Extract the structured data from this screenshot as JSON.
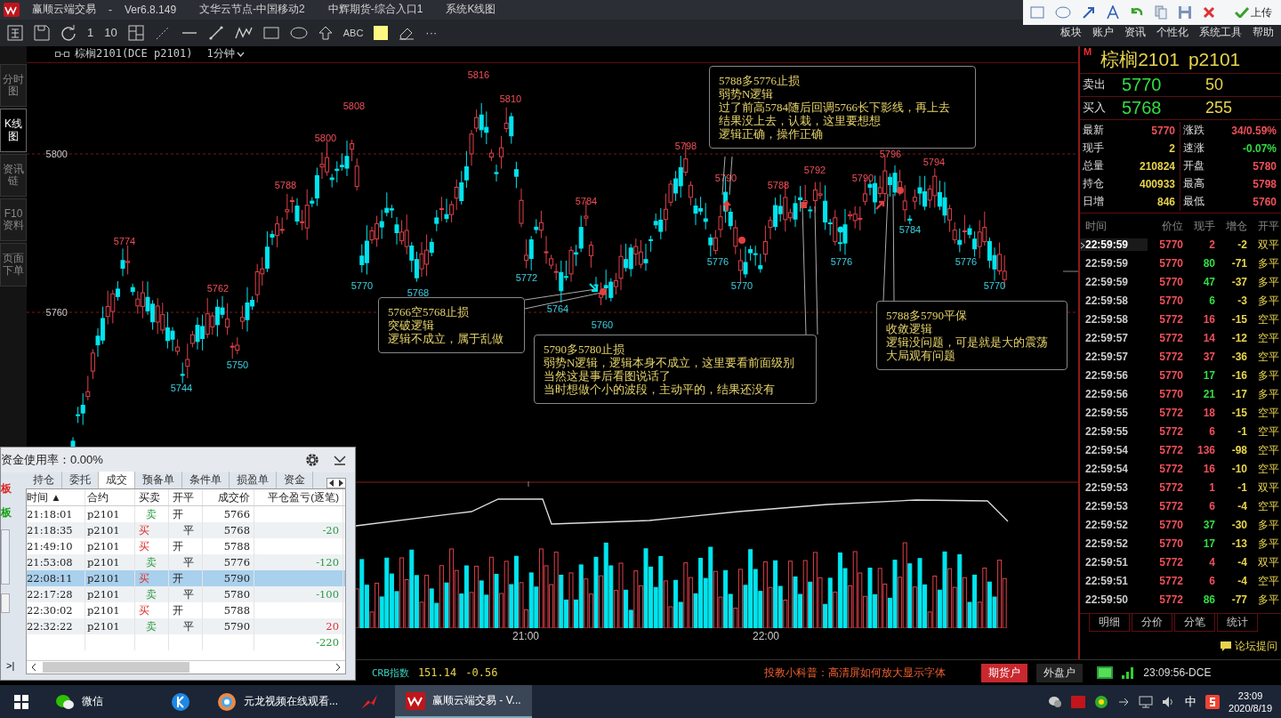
{
  "title_bar": {
    "app_name": "赢顺云端交易",
    "separator": "-",
    "version": "Ver6.8.149",
    "items": [
      "文华云节点-中国移动2",
      "中辉期货-综合入口1",
      "系统K线图"
    ]
  },
  "draw_toolbar": {
    "upload_label": "上传"
  },
  "toolbar": {
    "one": "1",
    "ten": "10",
    "abc": "ABC",
    "more": "···"
  },
  "menu": [
    "板块",
    "账户",
    "资讯",
    "个性化",
    "系统工具",
    "帮助"
  ],
  "chart_header": {
    "symbol": "棕榈2101(DCE p2101)",
    "period": "1分钟"
  },
  "side_tabs": [
    {
      "label": "分时图",
      "selected": false
    },
    {
      "label": "K线图",
      "selected": true
    },
    {
      "label": "资讯链",
      "selected": false
    },
    {
      "label": "F10资料",
      "selected": false
    },
    {
      "label": "页面下单",
      "selected": false
    }
  ],
  "price_axis": [
    "5800",
    "5760"
  ],
  "time_axis": [
    "21:00",
    "22:00"
  ],
  "price_marks": [
    {
      "text": "5774",
      "kind": "high"
    },
    {
      "text": "5744",
      "kind": "low"
    },
    {
      "text": "5762",
      "kind": "high"
    },
    {
      "text": "5750",
      "kind": "low"
    },
    {
      "text": "5788",
      "kind": "high"
    },
    {
      "text": "5800",
      "kind": "high"
    },
    {
      "text": "5808",
      "kind": "high"
    },
    {
      "text": "5770",
      "kind": "low"
    },
    {
      "text": "5768",
      "kind": "low"
    },
    {
      "text": "5816",
      "kind": "high"
    },
    {
      "text": "5810",
      "kind": "high"
    },
    {
      "text": "5772",
      "kind": "low"
    },
    {
      "text": "5764",
      "kind": "low"
    },
    {
      "text": "5784",
      "kind": "high"
    },
    {
      "text": "5760",
      "kind": "low"
    },
    {
      "text": "5798",
      "kind": "high"
    },
    {
      "text": "5776",
      "kind": "low"
    },
    {
      "text": "5790",
      "kind": "high"
    },
    {
      "text": "5770",
      "kind": "low"
    },
    {
      "text": "5788",
      "kind": "high"
    },
    {
      "text": "5792",
      "kind": "high"
    },
    {
      "text": "5776",
      "kind": "low"
    },
    {
      "text": "5790",
      "kind": "high"
    },
    {
      "text": "5796",
      "kind": "high"
    },
    {
      "text": "5784",
      "kind": "low"
    },
    {
      "text": "5794",
      "kind": "high"
    },
    {
      "text": "5776",
      "kind": "low"
    },
    {
      "text": "5770",
      "kind": "low"
    }
  ],
  "annotations": [
    {
      "lines": [
        "5766空5768止损",
        "突破逻辑",
        "逻辑不成立，属于乱做"
      ]
    },
    {
      "lines": [
        "5790多5780止损",
        "弱势N逻辑，逻辑本身不成立，这里要看前面级别",
        "当然这是事后看图说话了",
        "当时想做个小的波段，主动平的，结果还没有"
      ]
    },
    {
      "lines": [
        "5788多5776止损",
        "弱势N逻辑",
        "过了前高5784随后回调5766长下影线，再上去",
        "结果没上去，认栽，这里要想想",
        "逻辑正确，操作正确"
      ]
    },
    {
      "lines": [
        "5788多5790平保",
        "收敛逻辑",
        "逻辑没问题，可是就是大的震荡",
        "大局观有问题"
      ]
    }
  ],
  "quote": {
    "badge": "M",
    "name": "棕榈2101",
    "code": "p2101",
    "ask": {
      "label": "卖出",
      "price": "5770",
      "volume": "50"
    },
    "bid": {
      "label": "买入",
      "price": "5768",
      "volume": "255"
    },
    "stats": [
      {
        "label": "最新",
        "value": "5770",
        "color": "#f0505a"
      },
      {
        "label": "涨跌",
        "value": "34/0.59%",
        "color": "#f0505a"
      },
      {
        "label": "现手",
        "value": "2",
        "color": "#e8d44d"
      },
      {
        "label": "速涨",
        "value": "-0.07%",
        "color": "#33dd44"
      },
      {
        "label": "总量",
        "value": "210824",
        "color": "#e8d44d"
      },
      {
        "label": "开盘",
        "value": "5780",
        "color": "#f0505a"
      },
      {
        "label": "持仓",
        "value": "400933",
        "color": "#e8d44d"
      },
      {
        "label": "最高",
        "value": "5798",
        "color": "#f0505a"
      },
      {
        "label": "日增",
        "value": "846",
        "color": "#e8d44d"
      },
      {
        "label": "最低",
        "value": "5760",
        "color": "#f0505a"
      }
    ]
  },
  "ticks": {
    "columns": [
      "时间",
      "价位",
      "现手",
      "增仓",
      "开平"
    ],
    "rows": [
      {
        "time": "22:59:59",
        "price": "5770",
        "volume": "2",
        "color": "#f0505a",
        "change": "-2",
        "type": "双平",
        "selected": true
      },
      {
        "time": "22:59:59",
        "price": "5770",
        "volume": "80",
        "color": "#33dd44",
        "change": "-71",
        "type": "多平",
        "selected": false
      },
      {
        "time": "22:59:59",
        "price": "5770",
        "volume": "47",
        "color": "#33dd44",
        "change": "-37",
        "type": "多平",
        "selected": false
      },
      {
        "time": "22:59:58",
        "price": "5770",
        "volume": "6",
        "color": "#33dd44",
        "change": "-3",
        "type": "多平",
        "selected": false
      },
      {
        "time": "22:59:58",
        "price": "5772",
        "volume": "16",
        "color": "#f0505a",
        "change": "-15",
        "type": "空平",
        "selected": false
      },
      {
        "time": "22:59:57",
        "price": "5772",
        "volume": "14",
        "color": "#f0505a",
        "change": "-12",
        "type": "空平",
        "selected": false
      },
      {
        "time": "22:59:57",
        "price": "5772",
        "volume": "37",
        "color": "#f0505a",
        "change": "-36",
        "type": "空平",
        "selected": false
      },
      {
        "time": "22:59:56",
        "price": "5770",
        "volume": "17",
        "color": "#33dd44",
        "change": "-16",
        "type": "多平",
        "selected": false
      },
      {
        "time": "22:59:56",
        "price": "5770",
        "volume": "21",
        "color": "#33dd44",
        "change": "-17",
        "type": "多平",
        "selected": false
      },
      {
        "time": "22:59:55",
        "price": "5772",
        "volume": "18",
        "color": "#f0505a",
        "change": "-15",
        "type": "空平",
        "selected": false
      },
      {
        "time": "22:59:55",
        "price": "5772",
        "volume": "6",
        "color": "#f0505a",
        "change": "-1",
        "type": "空平",
        "selected": false
      },
      {
        "time": "22:59:54",
        "price": "5772",
        "volume": "136",
        "color": "#f0505a",
        "change": "-98",
        "type": "空平",
        "selected": false
      },
      {
        "time": "22:59:54",
        "price": "5772",
        "volume": "16",
        "color": "#f0505a",
        "change": "-10",
        "type": "空平",
        "selected": false
      },
      {
        "time": "22:59:53",
        "price": "5772",
        "volume": "1",
        "color": "#f0505a",
        "change": "-1",
        "type": "双平",
        "selected": false
      },
      {
        "time": "22:59:53",
        "price": "5772",
        "volume": "6",
        "color": "#f0505a",
        "change": "-4",
        "type": "空平",
        "selected": false
      },
      {
        "time": "22:59:52",
        "price": "5770",
        "volume": "37",
        "color": "#33dd44",
        "change": "-30",
        "type": "多平",
        "selected": false
      },
      {
        "time": "22:59:52",
        "price": "5770",
        "volume": "17",
        "color": "#33dd44",
        "change": "-13",
        "type": "多平",
        "selected": false
      },
      {
        "time": "22:59:51",
        "price": "5772",
        "volume": "4",
        "color": "#f0505a",
        "change": "-4",
        "type": "双平",
        "selected": false
      },
      {
        "time": "22:59:51",
        "price": "5772",
        "volume": "6",
        "color": "#f0505a",
        "change": "-4",
        "type": "空平",
        "selected": false
      },
      {
        "time": "22:59:50",
        "price": "5772",
        "volume": "86",
        "color": "#33dd44",
        "change": "-77",
        "type": "多平",
        "selected": false
      }
    ]
  },
  "bottom_tabs": [
    "明细",
    "分价",
    "分笔",
    "统计"
  ],
  "forum_link": "论坛提问",
  "order_panel": {
    "title": "资金使用率：0.00%",
    "side_labels": [
      {
        "text": "板",
        "color": "#e02020"
      },
      {
        "text": "板",
        "color": "#10a010"
      }
    ],
    "tabs": [
      {
        "label": "持仓",
        "selected": false
      },
      {
        "label": "委托",
        "selected": false
      },
      {
        "label": "成交",
        "selected": true
      },
      {
        "label": "预备单",
        "selected": false
      },
      {
        "label": "条件单",
        "selected": false
      },
      {
        "label": "损盈单",
        "selected": false
      },
      {
        "label": "资金",
        "selected": false
      }
    ],
    "columns": [
      "时间 ▲",
      "合约",
      "买卖",
      "开平",
      "成交价",
      "平仓盈亏(逐笔)"
    ],
    "rows": [
      {
        "time": "21:18:01",
        "contract": "p2101",
        "buy": false,
        "side_text": "卖",
        "close": false,
        "offset_text": "开",
        "price": "5766",
        "selected": false
      },
      {
        "time": "21:18:35",
        "contract": "p2101",
        "buy": true,
        "side_text": "买",
        "close": true,
        "offset_text": "平",
        "price": "5768",
        "pnl": "-20",
        "color": "#2a9a40",
        "selected": false
      },
      {
        "time": "21:49:10",
        "contract": "p2101",
        "buy": true,
        "side_text": "买",
        "close": false,
        "offset_text": "开",
        "price": "5788",
        "selected": false
      },
      {
        "time": "21:53:08",
        "contract": "p2101",
        "buy": false,
        "side_text": "卖",
        "close": true,
        "offset_text": "平",
        "price": "5776",
        "pnl": "-120",
        "color": "#2a9a40",
        "selected": false
      },
      {
        "time": "22:08:11",
        "contract": "p2101",
        "buy": true,
        "side_text": "买",
        "close": false,
        "offset_text": "开",
        "price": "5790",
        "selected": true
      },
      {
        "time": "22:17:28",
        "contract": "p2101",
        "buy": false,
        "side_text": "卖",
        "close": true,
        "offset_text": "平",
        "price": "5780",
        "pnl": "-100",
        "color": "#2a9a40",
        "selected": false
      },
      {
        "time": "22:30:02",
        "contract": "p2101",
        "buy": true,
        "side_text": "买",
        "close": false,
        "offset_text": "开",
        "price": "5788",
        "selected": false
      },
      {
        "time": "22:32:22",
        "contract": "p2101",
        "buy": false,
        "side_text": "卖",
        "close": true,
        "offset_text": "平",
        "price": "5790",
        "pnl": "20",
        "color": "#e03030",
        "selected": false
      }
    ],
    "total": "-220",
    "end_button": ">|"
  },
  "status_bar": {
    "index_name": "CRB指数",
    "index_value": "151.14",
    "index_change": "-0.56",
    "tip": "投教小科普：高清屏如何放大显示字体",
    "accounts": [
      {
        "label": "期货户",
        "selected": true
      },
      {
        "label": "外盘户",
        "selected": false
      }
    ],
    "clock": "23:09:56-DCE"
  },
  "taskbar": {
    "apps": [
      {
        "kind": "chat",
        "label": "微信",
        "selected": false
      },
      {
        "kind": "k",
        "selected": false
      },
      {
        "kind": "video",
        "label": "元龙视频在线观看...",
        "selected": false
      },
      {
        "kind": "red",
        "selected": false
      },
      {
        "kind": "trading",
        "label": "赢顺云端交易 - V...",
        "selected": true
      }
    ],
    "ime": "中",
    "time": "23:09",
    "date": "2020/8/19"
  }
}
